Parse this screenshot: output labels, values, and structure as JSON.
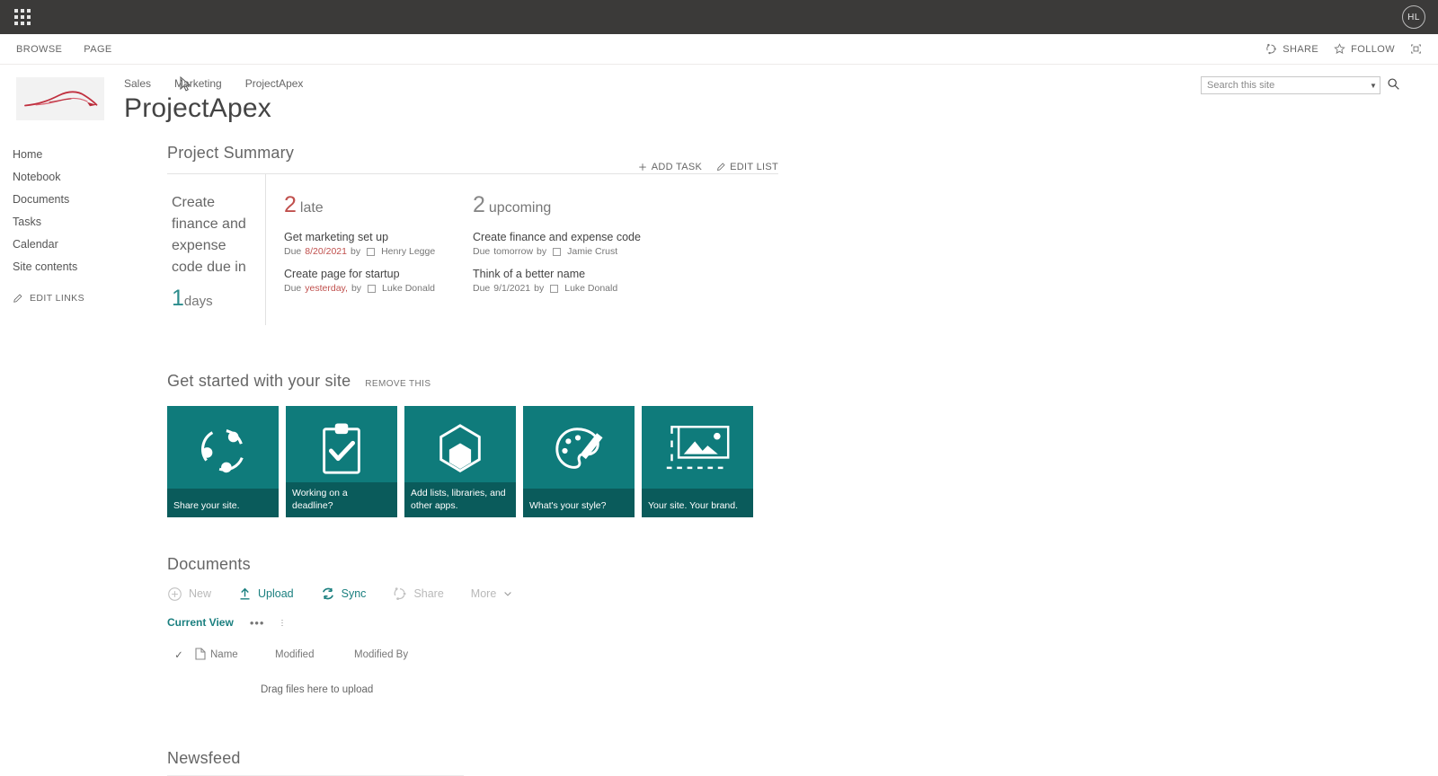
{
  "suite": {
    "waffle": "app-launcher-icon",
    "avatar_initials": "HL"
  },
  "ribbon": {
    "tabs": [
      {
        "label": "BROWSE"
      },
      {
        "label": "PAGE"
      }
    ],
    "share_label": "SHARE",
    "follow_label": "FOLLOW",
    "focus_label": "focus-on-content-icon"
  },
  "header": {
    "breadcrumbs": [
      {
        "label": "Sales"
      },
      {
        "label": "Marketing"
      },
      {
        "label": "ProjectApex"
      }
    ],
    "site_title": "ProjectApex",
    "logo_alt": "site-logo-car"
  },
  "search": {
    "placeholder": "Search this site",
    "value": ""
  },
  "quicklaunch": {
    "items": [
      {
        "label": "Home"
      },
      {
        "label": "Notebook"
      },
      {
        "label": "Documents"
      },
      {
        "label": "Tasks"
      },
      {
        "label": "Calendar"
      },
      {
        "label": "Site contents"
      }
    ],
    "edit_links": "EDIT LINKS"
  },
  "project_summary": {
    "title": "Project Summary",
    "add_task": "ADD TASK",
    "edit_list": "EDIT LIST",
    "left_text": "Create finance and expense code due in",
    "days_number": "1",
    "days_unit": "days",
    "late": {
      "count": "2",
      "label": "late",
      "tasks": [
        {
          "name": "Get marketing set up",
          "due_prefix": "Due",
          "due": "8/20/2021",
          "by": "by",
          "assignee": "Henry Legge",
          "overdue": true
        },
        {
          "name": "Create page for startup",
          "due_prefix": "Due",
          "due": "yesterday,",
          "by": "by",
          "assignee": "Luke Donald",
          "overdue": true
        }
      ]
    },
    "upcoming": {
      "count": "2",
      "label": "upcoming",
      "tasks": [
        {
          "name": "Create finance and expense code",
          "due_prefix": "Due",
          "due": "tomorrow",
          "by": "by",
          "assignee": "Jamie Crust",
          "overdue": false
        },
        {
          "name": "Think of a better name",
          "due_prefix": "Due",
          "due": "9/1/2021",
          "by": "by",
          "assignee": "Luke Donald",
          "overdue": false
        }
      ]
    }
  },
  "get_started": {
    "title": "Get started with your site",
    "remove_label": "REMOVE THIS",
    "tiles": [
      {
        "caption": "Share your site.",
        "icon": "share-network-icon"
      },
      {
        "caption": "Working on a deadline?",
        "icon": "clipboard-check-icon"
      },
      {
        "caption": "Add lists, libraries, and other apps.",
        "icon": "apps-hexagon-icon"
      },
      {
        "caption": "What's your style?",
        "icon": "palette-brush-icon"
      },
      {
        "caption": "Your site. Your brand.",
        "icon": "image-frame-icon"
      }
    ],
    "tile_color": "#0f7b7b",
    "tile_caption_color": "#0a5b5b"
  },
  "documents": {
    "title": "Documents",
    "toolbar": [
      {
        "label": "New",
        "icon": "plus-circle-icon",
        "state": "disabled"
      },
      {
        "label": "Upload",
        "icon": "upload-arrow-icon",
        "state": "active"
      },
      {
        "label": "Sync",
        "icon": "sync-arrows-icon",
        "state": "active"
      },
      {
        "label": "Share",
        "icon": "share-network-icon",
        "state": "disabled"
      },
      {
        "label": "More",
        "icon": "chevron-down-icon",
        "state": "disabled"
      }
    ],
    "current_view": "Current View",
    "columns": [
      {
        "label": "Name"
      },
      {
        "label": "Modified"
      },
      {
        "label": "Modified By"
      }
    ],
    "empty_message": "Drag files here to upload",
    "rows": []
  },
  "newsfeed": {
    "title": "Newsfeed"
  },
  "colors": {
    "accent_teal": "#0f7b7b",
    "overdue_red": "#c0504d",
    "suitebar": "#3b3a39"
  }
}
